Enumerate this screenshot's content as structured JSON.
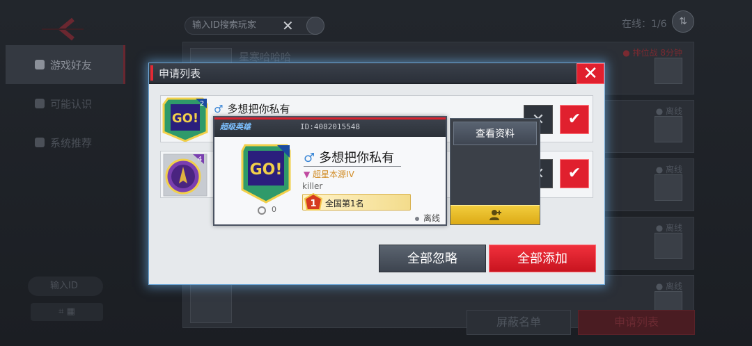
{
  "background": {
    "search_placeholder": "输入ID搜索玩家",
    "online_label": "在线：1/6",
    "sidebar": [
      {
        "label": "游戏好友",
        "active": true
      },
      {
        "label": "可能认识",
        "active": false
      },
      {
        "label": "系统推荐",
        "active": false
      }
    ],
    "side_search_placeholder": "输入ID",
    "friends": [
      {
        "name": "星寒哈哈哈",
        "status": "● 排位战 8分钟",
        "status_color": "#7a2a31"
      },
      {
        "name": "",
        "status": "● 离线",
        "status_color": "#4f555e"
      },
      {
        "name": "",
        "status": "● 离线",
        "status_color": "#4f555e"
      },
      {
        "name": "",
        "status": "● 离线",
        "status_color": "#4f555e"
      },
      {
        "name": "",
        "status": "● 离线",
        "status_color": "#4f555e"
      }
    ],
    "block_list_label": "屏蔽名单",
    "apply_list_label": "申请列表"
  },
  "modal": {
    "title": "申请列表",
    "close_icon": "close-icon",
    "requests": [
      {
        "name": "多想把你私有",
        "gender_icon": "male-icon",
        "level": "2",
        "avatar": "go-avatar"
      },
      {
        "name": "",
        "gender_icon": "male-icon",
        "level": "4",
        "avatar": "groot-avatar"
      }
    ],
    "ignore_all_label": "全部忽略",
    "add_all_label": "全部添加"
  },
  "profile_popup": {
    "id_text": "ID:4082015548",
    "logo_text": "超级英雄",
    "name": "多想把你私有",
    "level": "2",
    "rank_title": "超星本源IV",
    "guild": "killer",
    "badge_rank": "1",
    "badge_text": "全国第1名",
    "bottom_count": "0",
    "status": "离线"
  },
  "action_menu": {
    "view_profile_label": "查看资料",
    "add_friend_icon": "add-friend-icon"
  },
  "colors": {
    "accent_red": "#e0202e",
    "modal_glow": "#6fa8d8",
    "gold": "#dcaa16"
  }
}
